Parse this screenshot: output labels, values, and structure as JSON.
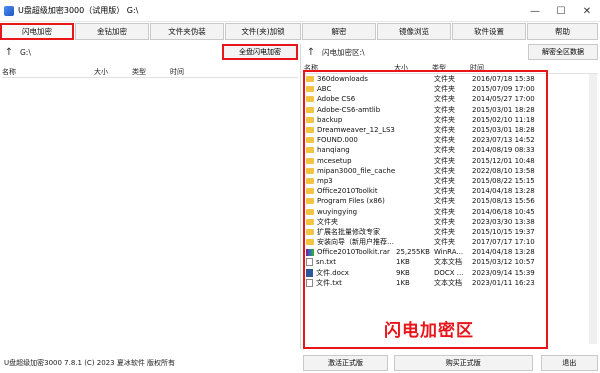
{
  "window": {
    "title": "U盘超级加密3000（试用版） G:\\",
    "minimize": "—",
    "maximize": "☐",
    "close": "✕"
  },
  "toolbar": {
    "buttons": [
      {
        "label": "闪电加密"
      },
      {
        "label": "金钻加密"
      },
      {
        "label": "文件夹伪装"
      },
      {
        "label": "文件(夹)加锁"
      },
      {
        "label": "解密"
      },
      {
        "label": "镜像浏览"
      },
      {
        "label": "软件设置"
      },
      {
        "label": "帮助"
      }
    ]
  },
  "left_pane": {
    "path": "G:\\",
    "up_arrow": "↑",
    "encrypt_all_label": "全盘闪电加密",
    "columns": {
      "name": "名称",
      "size": "大小",
      "type": "类型",
      "time": "时间"
    }
  },
  "right_pane": {
    "path": "闪电加密区:\\",
    "up_arrow": "↑",
    "decrypt_all_label": "解密全区数据",
    "columns": {
      "name": "名称",
      "size": "大小",
      "type": "类型",
      "time": "时间"
    },
    "zone_label": "闪电加密区",
    "files": [
      {
        "icon": "folder",
        "name": "360downloads",
        "size": "",
        "type": "文件夹",
        "time": "2016/07/18 15:38"
      },
      {
        "icon": "folder",
        "name": "ABC",
        "size": "",
        "type": "文件夹",
        "time": "2015/07/09 17:00"
      },
      {
        "icon": "folder",
        "name": "Adobe CS6",
        "size": "",
        "type": "文件夹",
        "time": "2014/05/27 17:00"
      },
      {
        "icon": "folder",
        "name": "Adobe-CS6-amtlib",
        "size": "",
        "type": "文件夹",
        "time": "2015/03/01 18:28"
      },
      {
        "icon": "folder",
        "name": "backup",
        "size": "",
        "type": "文件夹",
        "time": "2015/02/10 11:18"
      },
      {
        "icon": "folder",
        "name": "Dreamweaver_12_LS3",
        "size": "",
        "type": "文件夹",
        "time": "2015/03/01 18:28"
      },
      {
        "icon": "folder",
        "name": "FOUND.000",
        "size": "",
        "type": "文件夹",
        "time": "2023/07/13 14:52"
      },
      {
        "icon": "folder",
        "name": "hanqiang",
        "size": "",
        "type": "文件夹",
        "time": "2014/08/19 08:33"
      },
      {
        "icon": "folder",
        "name": "mcesetup",
        "size": "",
        "type": "文件夹",
        "time": "2015/12/01 10:48"
      },
      {
        "icon": "folder",
        "name": "mipan3000_file_cache",
        "size": "",
        "type": "文件夹",
        "time": "2022/08/10 13:58"
      },
      {
        "icon": "folder",
        "name": "mp3",
        "size": "",
        "type": "文件夹",
        "time": "2015/08/22 15:15"
      },
      {
        "icon": "folder",
        "name": "Office2010Toolkit",
        "size": "",
        "type": "文件夹",
        "time": "2014/04/18 13:28"
      },
      {
        "icon": "folder",
        "name": "Program Files (x86)",
        "size": "",
        "type": "文件夹",
        "time": "2015/08/13 15:56"
      },
      {
        "icon": "folder",
        "name": "wuyingying",
        "size": "",
        "type": "文件夹",
        "time": "2014/06/18 10:45"
      },
      {
        "icon": "folder",
        "name": "文件夹",
        "size": "",
        "type": "文件夹",
        "time": "2023/03/30 13:38"
      },
      {
        "icon": "folder",
        "name": "扩展名批量修改专家",
        "size": "",
        "type": "文件夹",
        "time": "2015/10/15 19:37"
      },
      {
        "icon": "folder",
        "name": "安装向导（新用户推荐…",
        "size": "",
        "type": "文件夹",
        "time": "2017/07/17 17:10"
      },
      {
        "icon": "rar",
        "name": "Office2010Toolkit.rar",
        "size": "25,255KB",
        "type": "WinRA...",
        "time": "2014/04/18 13:28"
      },
      {
        "icon": "txt",
        "name": "sn.txt",
        "size": "1KB",
        "type": "文本文档",
        "time": "2015/03/12 10:57"
      },
      {
        "icon": "doc",
        "name": "文件.docx",
        "size": "9KB",
        "type": "DOCX ...",
        "time": "2023/09/14 15:39"
      },
      {
        "icon": "txt",
        "name": "文件.txt",
        "size": "1KB",
        "type": "文本文档",
        "time": "2023/01/11 16:23"
      }
    ]
  },
  "status": {
    "text": "U盘超级加密3000 7.8.1 (C) 2023 夏冰软件 版权所有",
    "activate_label": "激活正式版",
    "buy_label": "购买正式版",
    "exit_label": "退出"
  },
  "colors": {
    "highlight": "#e8161b",
    "folder": "#f3c344"
  }
}
